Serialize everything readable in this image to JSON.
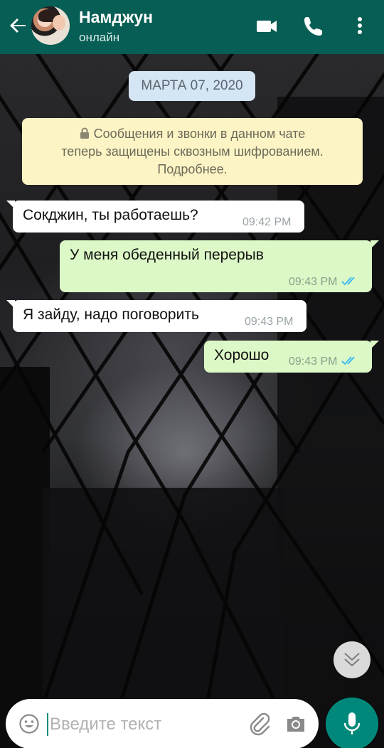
{
  "colors": {
    "header_bg": "#075e54",
    "incoming_bubble": "#ffffff",
    "outgoing_bubble": "#dcf8c6",
    "notice_bg": "#fcf4c4",
    "date_pill_bg": "#d4e5f3",
    "read_ticks": "#34b7f1",
    "mic_button": "#00897b"
  },
  "header": {
    "contact_name": "Намджун",
    "status": "онлайн",
    "icons": [
      "back-arrow-icon",
      "video-call-icon",
      "voice-call-icon",
      "more-vert-icon"
    ]
  },
  "chat": {
    "date": "МАРТА 07, 2020",
    "encryption_notice": {
      "line1": "Сообщения и звонки в данном чате",
      "line2": "теперь защищены сквозным шифрованием.",
      "line3": "Подробнее."
    },
    "messages": [
      {
        "direction": "in",
        "text": "Сокджин, ты работаешь?",
        "time": "09:42 PM"
      },
      {
        "direction": "out",
        "text": "У меня обеденный перерыв",
        "time": "09:43 PM",
        "status": "read"
      },
      {
        "direction": "in",
        "text": "Я зайду, надо поговорить",
        "time": "09:43 PM"
      },
      {
        "direction": "out",
        "text": "Хорошо",
        "time": "09:43 PM",
        "status": "read"
      }
    ]
  },
  "composer": {
    "placeholder": "Введите текст",
    "value": ""
  }
}
